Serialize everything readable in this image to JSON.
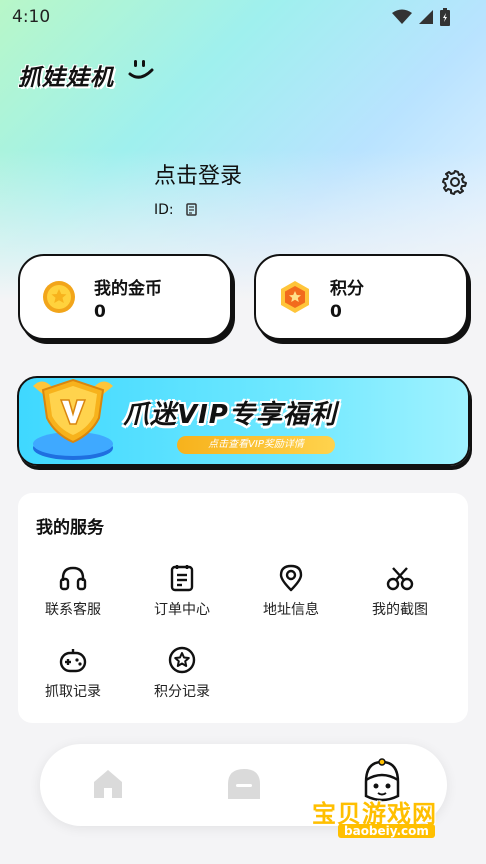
{
  "status_bar": {
    "time": "4:10"
  },
  "header": {
    "app_logo_text": "抓娃娃机"
  },
  "profile": {
    "login_text": "点击登录",
    "id_label": "ID:"
  },
  "cards": {
    "coins": {
      "title": "我的金币",
      "value": "0"
    },
    "points": {
      "title": "积分",
      "value": "0"
    }
  },
  "vip_banner": {
    "title": "爪迷VIP专享福利",
    "subtitle": "点击查看VIP奖励详情"
  },
  "services": {
    "title": "我的服务",
    "items": [
      {
        "label": "联系客服",
        "icon": "headphones-icon"
      },
      {
        "label": "订单中心",
        "icon": "order-list-icon"
      },
      {
        "label": "地址信息",
        "icon": "location-pin-icon"
      },
      {
        "label": "我的截图",
        "icon": "scissors-icon"
      },
      {
        "label": "抓取记录",
        "icon": "gamepad-icon"
      },
      {
        "label": "积分记录",
        "icon": "star-badge-icon"
      }
    ]
  },
  "watermark": {
    "text": "宝贝游戏网",
    "url": "baobeiy.com"
  },
  "colors": {
    "accent_gold": "#f7b21c",
    "banner_cyan": "#3fd8ff",
    "points_orange": "#f26b1d"
  }
}
